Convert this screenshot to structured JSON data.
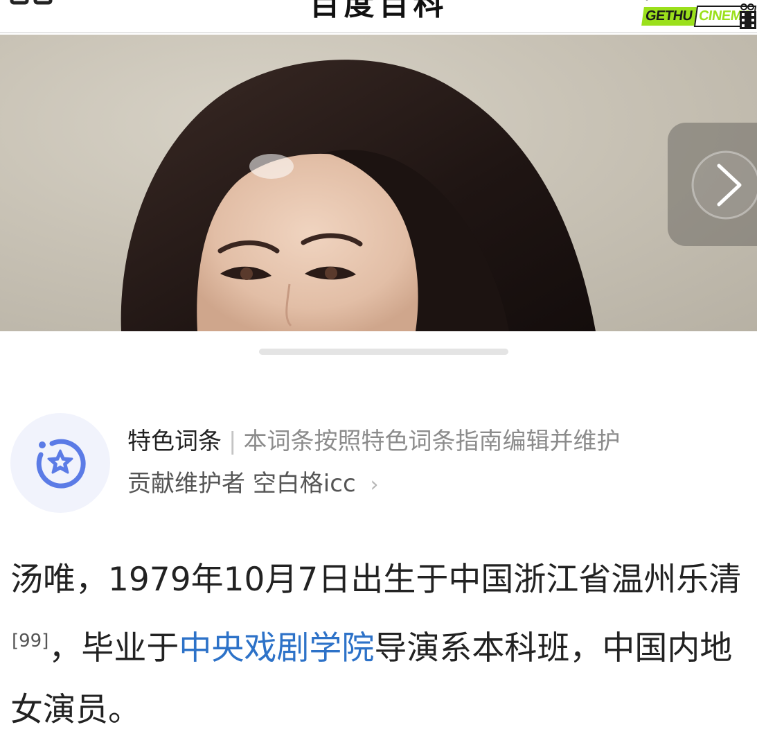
{
  "header": {
    "title": "百度百科",
    "watermark": {
      "part1": "GETHU",
      "part2": "CINEMA"
    }
  },
  "hero": {
    "next_icon": "chevron-right-icon"
  },
  "featured": {
    "label": "特色词条",
    "separator": "|",
    "description": "本词条按照特色词条指南编辑并维护",
    "maintainer_prefix": "贡献维护者",
    "maintainer_name": "空白格icc",
    "chevron": "›"
  },
  "summary": {
    "part1": "汤唯，1979年10月7日出生于中国浙江省温州乐清",
    "citation": "[99]",
    "part2": "，毕业于",
    "link_text": "中央戏剧学院",
    "part3": "导演系本科班，中国内地女演员。"
  },
  "colors": {
    "link": "#2d72c8",
    "badge_blue": "#5b7be6"
  }
}
